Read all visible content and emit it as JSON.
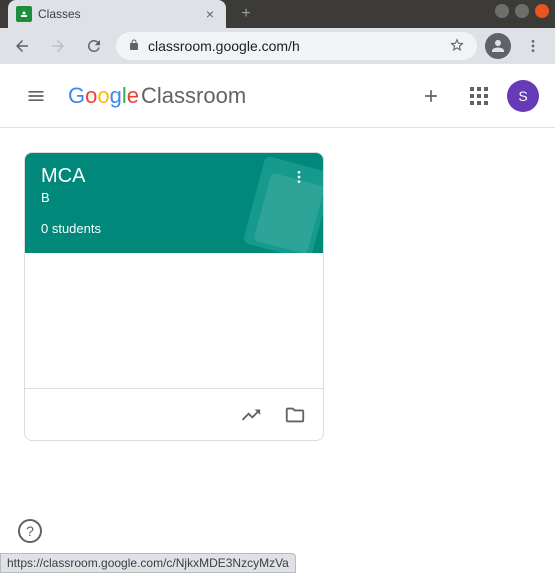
{
  "tab": {
    "title": "Classes"
  },
  "address": {
    "url": "classroom.google.com/h"
  },
  "logo": {
    "g": "G",
    "o1": "o",
    "o2": "o",
    "g2": "g",
    "l": "l",
    "e": "e",
    "product": " Classroom"
  },
  "user": {
    "initial": "S"
  },
  "class_cards": [
    {
      "title": "MCA",
      "section": "B",
      "students_text": "0 students",
      "theme_color": "#00897b"
    }
  ],
  "status_bar": {
    "url": "https://classroom.google.com/c/NjkxMDE3NzcyMzVa"
  },
  "help": {
    "symbol": "?"
  }
}
